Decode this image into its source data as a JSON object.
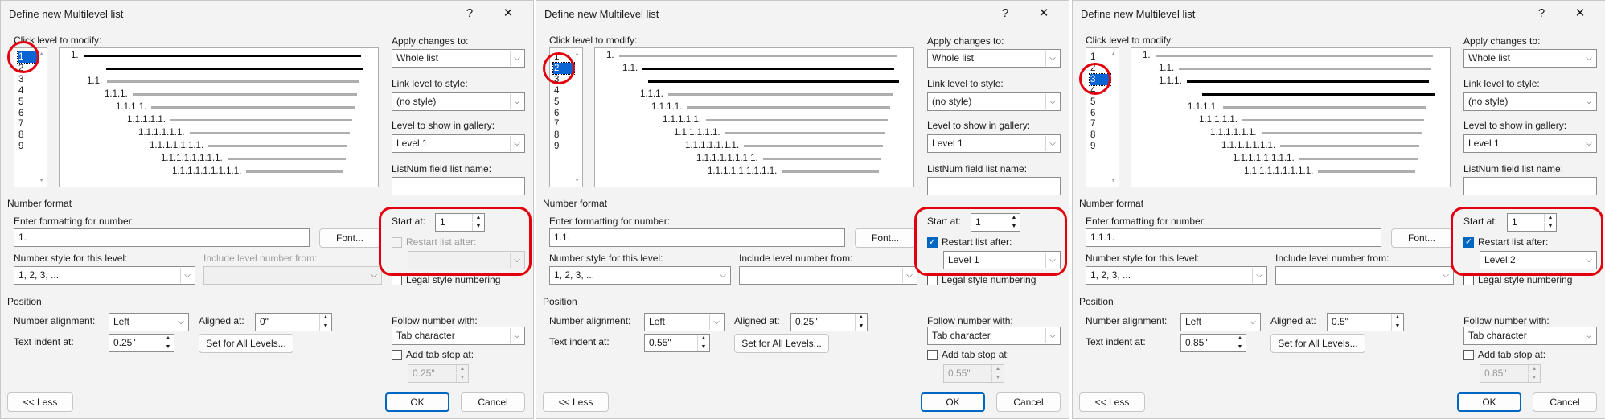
{
  "dialogs": [
    {
      "title": "Define new Multilevel list",
      "levels": [
        "1",
        "2",
        "3",
        "4",
        "5",
        "6",
        "7",
        "8",
        "9"
      ],
      "selected_level": 0,
      "preview_lines": [
        "1.",
        "",
        "1.1.",
        "1.1.1.",
        "1.1.1.1.",
        "1.1.1.1.1.",
        "1.1.1.1.1.1.",
        "1.1.1.1.1.1.1.",
        "1.1.1.1.1.1.1.1.",
        "1.1.1.1.1.1.1.1.1."
      ],
      "bold_lines": [
        0,
        1
      ],
      "formatting_value": "1.",
      "number_style": "1, 2, 3, ...",
      "include_level": "",
      "include_disabled": true,
      "start_at": "1",
      "restart_checked": false,
      "restart_disabled": true,
      "restart_after": "",
      "number_alignment": "Left",
      "aligned_at": "0\"",
      "text_indent": "0.25\"",
      "apply_changes": "Whole list",
      "link_level": "(no style)",
      "gallery_level": "Level 1",
      "listnum": "",
      "follow_with": "Tab character",
      "tab_stop": "0.25\""
    },
    {
      "title": "Define new Multilevel list",
      "levels": [
        "1",
        "2",
        "3",
        "4",
        "5",
        "6",
        "7",
        "8",
        "9"
      ],
      "selected_level": 1,
      "preview_lines": [
        "1.",
        "1.1.",
        "",
        "1.1.1.",
        "1.1.1.1.",
        "1.1.1.1.1.",
        "1.1.1.1.1.1.",
        "1.1.1.1.1.1.1.",
        "1.1.1.1.1.1.1.1.",
        "1.1.1.1.1.1.1.1.1."
      ],
      "bold_lines": [
        1,
        2
      ],
      "formatting_value": "1.1.",
      "number_style": "1, 2, 3, ...",
      "include_level": "",
      "include_disabled": false,
      "start_at": "1",
      "restart_checked": true,
      "restart_disabled": false,
      "restart_after": "Level 1",
      "number_alignment": "Left",
      "aligned_at": "0.25\"",
      "text_indent": "0.55\"",
      "apply_changes": "Whole list",
      "link_level": "(no style)",
      "gallery_level": "Level 1",
      "listnum": "",
      "follow_with": "Tab character",
      "tab_stop": "0.55\""
    },
    {
      "title": "Define new Multilevel list",
      "levels": [
        "1",
        "2",
        "3",
        "4",
        "5",
        "6",
        "7",
        "8",
        "9"
      ],
      "selected_level": 2,
      "preview_lines": [
        "1.",
        "1.1.",
        "1.1.1.",
        "",
        "1.1.1.1.",
        "1.1.1.1.1.",
        "1.1.1.1.1.1.",
        "1.1.1.1.1.1.1.",
        "1.1.1.1.1.1.1.1.",
        "1.1.1.1.1.1.1.1.1."
      ],
      "bold_lines": [
        2,
        3
      ],
      "formatting_value": "1.1.1.",
      "number_style": "1, 2, 3, ...",
      "include_level": "",
      "include_disabled": false,
      "start_at": "1",
      "restart_checked": true,
      "restart_disabled": false,
      "restart_after": "Level 2",
      "number_alignment": "Left",
      "aligned_at": "0.5\"",
      "text_indent": "0.85\"",
      "apply_changes": "Whole list",
      "link_level": "(no style)",
      "gallery_level": "Level 1",
      "listnum": "",
      "follow_with": "Tab character",
      "tab_stop": "0.85\""
    }
  ],
  "labels": {
    "help": "?",
    "close": "✕",
    "click_level": "Click level to modify:",
    "apply_changes_to": "Apply changes to:",
    "link_level_to_style": "Link level to style:",
    "level_to_show": "Level to show in gallery:",
    "listnum_name": "ListNum field list name:",
    "number_format": "Number format",
    "enter_formatting": "Enter formatting for number:",
    "font_button": "Font...",
    "number_style_for_level": "Number style for this level:",
    "include_level_from": "Include level number from:",
    "start_at": "Start at:",
    "restart_list_after": "Restart list after:",
    "legal_style": "Legal style numbering",
    "position": "Position",
    "number_alignment": "Number alignment:",
    "aligned_at": "Aligned at:",
    "text_indent_at": "Text indent at:",
    "set_for_all": "Set for All Levels...",
    "follow_number_with": "Follow number with:",
    "add_tab_stop": "Add tab stop at:",
    "less": "<< Less",
    "ok": "OK",
    "cancel": "Cancel"
  },
  "colors": {
    "annotation": "#e3000e",
    "accent": "#0067c0",
    "selection": "#0a64d4"
  }
}
